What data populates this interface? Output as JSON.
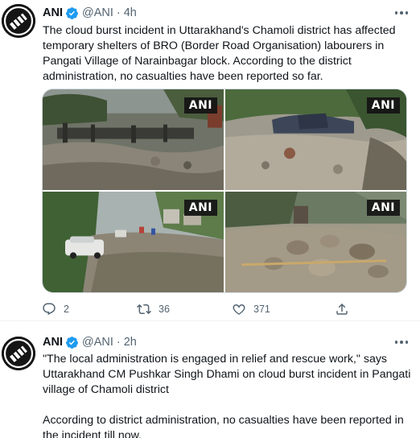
{
  "colors": {
    "text": "#0f1419",
    "secondary": "#536471",
    "verified": "#1d9bf0",
    "border": "#cfd9de",
    "badge_bg": "#141414"
  },
  "avatar_icon": "ani-logo",
  "tweets": [
    {
      "name": "ANI",
      "handle": "@ANI",
      "dot": "·",
      "time": "4h",
      "paragraphs": [
        "The cloud burst incident in Uttarakhand's Chamoli district has affected temporary shelters of BRO (Border Road Organisation) labourers in Pangati Village of Narainbagar block. According to the district administration, no casualties have been reported so far."
      ],
      "media": [
        {
          "badge": "ANI",
          "scene": "debris-covered-village"
        },
        {
          "badge": "ANI",
          "scene": "tarpaulin-shelters-buried"
        },
        {
          "badge": "ANI",
          "scene": "flooded-street-with-cars"
        },
        {
          "badge": "ANI",
          "scene": "boulder-debris"
        }
      ],
      "actions": {
        "replies": "2",
        "retweets": "36",
        "likes": "371"
      }
    },
    {
      "name": "ANI",
      "handle": "@ANI",
      "dot": "·",
      "time": "2h",
      "paragraphs": [
        "\"The local administration is engaged in relief and rescue work,\" says Uttarakhand CM Pushkar Singh Dhami on cloud burst incident in Pangati village of Chamoli district",
        "According to district administration, no casualties have been reported in the incident till now."
      ]
    }
  ]
}
